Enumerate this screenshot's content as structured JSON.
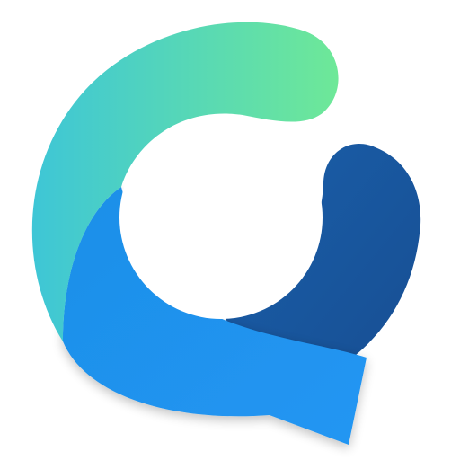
{
  "logo": {
    "icon": "speech-bubble-logo-icon",
    "colors": {
      "teal_start": "#3EC6D6",
      "green_end": "#6EE898",
      "blue_mid": "#1E8FE8",
      "blue_light": "#2196F3",
      "navy": "#1857A0",
      "background": "#FFFFFF"
    }
  }
}
